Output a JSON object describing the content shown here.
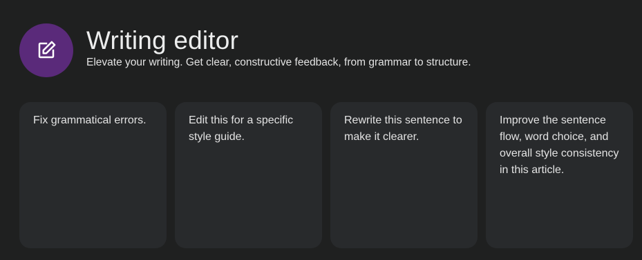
{
  "header": {
    "icon": "edit-icon",
    "avatar_color": "#5a2a7a",
    "title": "Writing editor",
    "subtitle": "Elevate your writing. Get clear, constructive feedback, from grammar to structure."
  },
  "suggestions": [
    {
      "text": "Fix grammatical errors."
    },
    {
      "text": "Edit this for a specific style guide."
    },
    {
      "text": "Rewrite this sentence to make it clearer."
    },
    {
      "text": "Improve the sentence flow, word choice, and overall style consistency in this article."
    }
  ]
}
